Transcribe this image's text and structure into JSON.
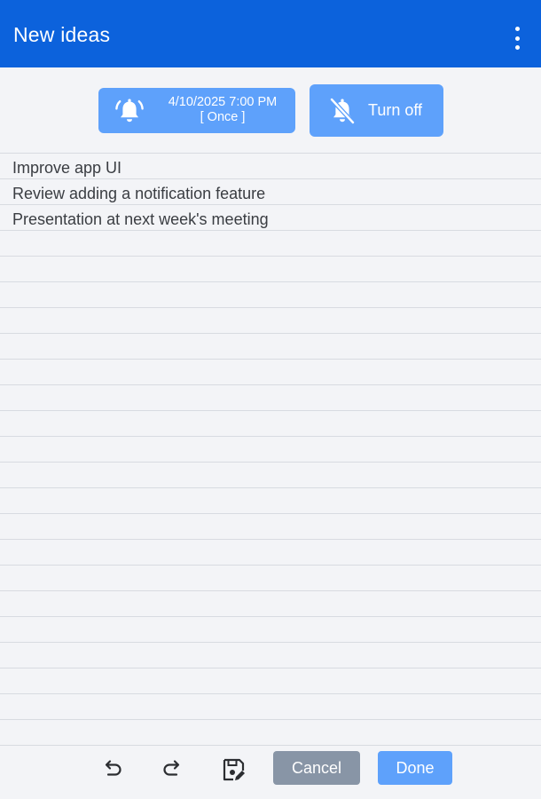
{
  "header": {
    "title": "New ideas",
    "menu_icon": "more-vertical-icon",
    "background_color": "#0c62dc"
  },
  "reminder": {
    "alarm_icon": "alarm-bell-icon",
    "datetime": "4/10/2025 7:00 PM",
    "repeat": "[ Once ]",
    "turn_off_icon": "bell-off-icon",
    "turn_off_label": "Turn off",
    "button_color": "#5ea1fb"
  },
  "note": {
    "lines": [
      "Improve app UI",
      "Review adding a notification feature",
      "Presentation at next week's meeting"
    ]
  },
  "toolbar": {
    "undo_icon": "undo-icon",
    "redo_icon": "redo-icon",
    "save_icon": "save-edit-icon",
    "cancel_label": "Cancel",
    "done_label": "Done",
    "cancel_color": "#8895a6",
    "done_color": "#5ea1fb"
  }
}
